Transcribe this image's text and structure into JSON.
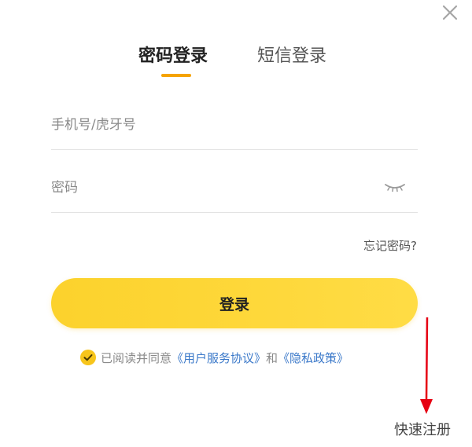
{
  "icons": {
    "close": "close-icon",
    "password_visibility": "eye-closed-icon",
    "agree_check": "check-circle-icon",
    "annotation": "red-arrow-icon"
  },
  "colors": {
    "accent": "#f5a300",
    "button": "#fcd22c",
    "link": "#3a78c9",
    "arrow": "#e60012"
  },
  "tabs": [
    {
      "label": "密码登录",
      "active": true
    },
    {
      "label": "短信登录",
      "active": false
    }
  ],
  "form": {
    "account_placeholder": "手机号/虎牙号",
    "account_value": "",
    "password_placeholder": "密码",
    "password_value": "",
    "forgot_password": "忘记密码?",
    "login_button": "登录"
  },
  "agreement": {
    "checked": true,
    "prefix": "已阅读并同意",
    "user_agreement": "《用户服务协议》",
    "and": "和",
    "privacy_policy": "《隐私政策》"
  },
  "register_link": "快速注册"
}
